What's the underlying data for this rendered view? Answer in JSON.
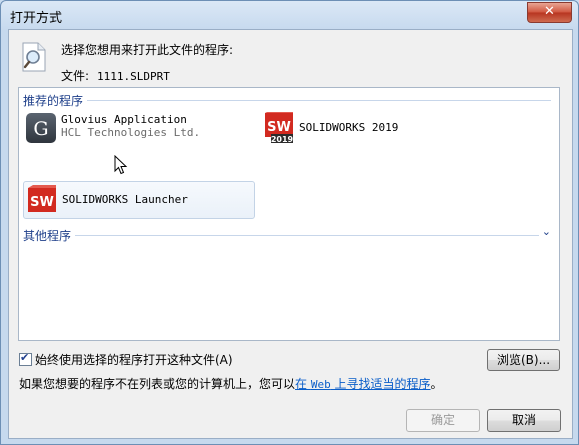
{
  "window": {
    "title": "打开方式",
    "close_glyph": "✕"
  },
  "header": {
    "prompt": "选择您想用来打开此文件的程序:",
    "file_label": "文件:",
    "file_name": "1111.SLDPRT",
    "icon": "magnifier-document-icon"
  },
  "recommended": {
    "header": "推荐的程序",
    "items": [
      {
        "name": "Glovius Application",
        "publisher": "HCL Technologies Ltd.",
        "icon": "glovius-g-icon",
        "glyph": "G"
      },
      {
        "name": "SOLIDWORKS 2019",
        "publisher": "",
        "icon": "solidworks-2019-icon",
        "glyph": "SW",
        "badge": "2019"
      },
      {
        "name": "SOLIDWORKS Launcher",
        "publisher": "",
        "icon": "solidworks-icon",
        "glyph": "SW"
      }
    ]
  },
  "other": {
    "header": "其他程序",
    "chevron": "⌄"
  },
  "options": {
    "always_use_label": "始终使用选择的程序打开这种文件(A)",
    "always_use_checked": true,
    "check_glyph": "✔"
  },
  "buttons": {
    "browse": "浏览(B)...",
    "ok": "确定",
    "cancel": "取消"
  },
  "footer": {
    "text_before": "如果您想要的程序不在列表或您的计算机上，您可以",
    "link_pre": "在 ",
    "link_web": "Web",
    "link_post": " 上寻找适当的程序",
    "text_after": "。"
  },
  "colors": {
    "accent": "#1e3f8a",
    "link": "#0b5ec9",
    "solidworks_red": "#d22a20"
  }
}
